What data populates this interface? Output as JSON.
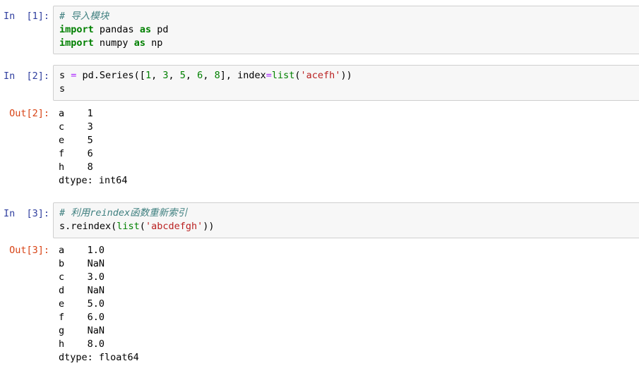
{
  "cells": [
    {
      "prompt": "In  [1]:",
      "lines": [
        [
          {
            "t": "# 导入模块",
            "c": "cm"
          }
        ],
        [
          {
            "t": "import",
            "c": "kw"
          },
          {
            "t": " pandas ",
            "c": ""
          },
          {
            "t": "as",
            "c": "kw"
          },
          {
            "t": " pd",
            "c": ""
          }
        ],
        [
          {
            "t": "import",
            "c": "kw"
          },
          {
            "t": " numpy ",
            "c": ""
          },
          {
            "t": "as",
            "c": "kw"
          },
          {
            "t": " np",
            "c": ""
          }
        ]
      ]
    },
    {
      "prompt": "In  [2]:",
      "lines": [
        [
          {
            "t": "s ",
            "c": ""
          },
          {
            "t": "=",
            "c": "opn"
          },
          {
            "t": " pd.Series([",
            "c": ""
          },
          {
            "t": "1",
            "c": "num"
          },
          {
            "t": ", ",
            "c": ""
          },
          {
            "t": "3",
            "c": "num"
          },
          {
            "t": ", ",
            "c": ""
          },
          {
            "t": "5",
            "c": "num"
          },
          {
            "t": ", ",
            "c": ""
          },
          {
            "t": "6",
            "c": "num"
          },
          {
            "t": ", ",
            "c": ""
          },
          {
            "t": "8",
            "c": "num"
          },
          {
            "t": "], index",
            "c": ""
          },
          {
            "t": "=",
            "c": "opn"
          },
          {
            "t": "list",
            "c": "bi"
          },
          {
            "t": "(",
            "c": ""
          },
          {
            "t": "'acefh'",
            "c": "str"
          },
          {
            "t": "))",
            "c": ""
          }
        ],
        [
          {
            "t": "s",
            "c": ""
          }
        ]
      ],
      "out_prompt": "Out[2]:",
      "output": [
        "a    1",
        "c    3",
        "e    5",
        "f    6",
        "h    8",
        "dtype: int64"
      ]
    },
    {
      "prompt": "In  [3]:",
      "lines": [
        [
          {
            "t": "# 利用reindex函数重新索引",
            "c": "cm"
          }
        ],
        [
          {
            "t": "s.reindex(",
            "c": ""
          },
          {
            "t": "list",
            "c": "bi"
          },
          {
            "t": "(",
            "c": ""
          },
          {
            "t": "'abcdefgh'",
            "c": "str"
          },
          {
            "t": "))",
            "c": ""
          }
        ]
      ],
      "out_prompt": "Out[3]:",
      "output": [
        "a    1.0",
        "b    NaN",
        "c    3.0",
        "d    NaN",
        "e    5.0",
        "f    6.0",
        "g    NaN",
        "h    8.0",
        "dtype: float64"
      ]
    }
  ]
}
